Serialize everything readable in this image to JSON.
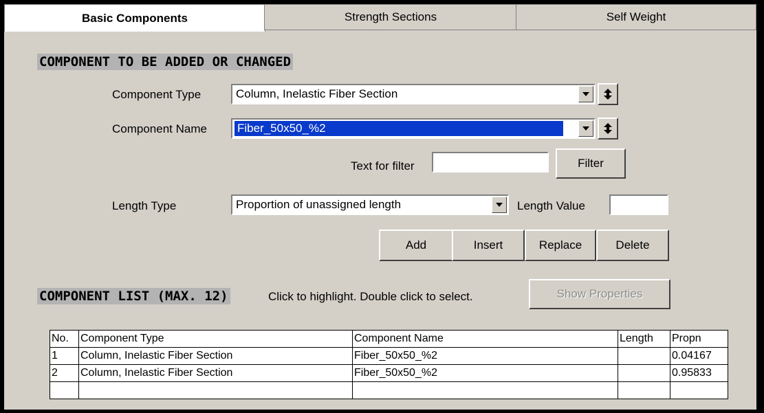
{
  "tabs": [
    {
      "label": "Basic Components",
      "active": true
    },
    {
      "label": "Strength Sections",
      "active": false
    },
    {
      "label": "Self Weight",
      "active": false
    }
  ],
  "section_add": {
    "title": "COMPONENT TO BE ADDED OR CHANGED",
    "component_type_label": "Component Type",
    "component_type_value": "Column, Inelastic Fiber Section",
    "component_name_label": "Component Name",
    "component_name_value": "Fiber_50x50_%2",
    "filter_label": "Text for filter",
    "filter_value": "",
    "filter_button": "Filter",
    "length_type_label": "Length Type",
    "length_type_value": "Proportion of unassigned length",
    "length_value_label": "Length Value",
    "length_value": "",
    "buttons": {
      "add": "Add",
      "insert": "Insert",
      "replace": "Replace",
      "delete": "Delete"
    }
  },
  "section_list": {
    "title": "COMPONENT LIST (MAX. 12)",
    "hint": "Click to highlight.  Double click to select.",
    "show_properties": "Show Properties",
    "columns": [
      "No.",
      "Component Type",
      "Component Name",
      "Length",
      "Propn"
    ],
    "rows": [
      [
        "1",
        "Column, Inelastic Fiber Section",
        "Fiber_50x50_%2",
        "",
        "0.04167"
      ],
      [
        "2",
        "Column, Inelastic Fiber Section",
        "Fiber_50x50_%2",
        "",
        "0.95833"
      ],
      [
        "",
        "",
        "",
        "",
        ""
      ]
    ]
  }
}
